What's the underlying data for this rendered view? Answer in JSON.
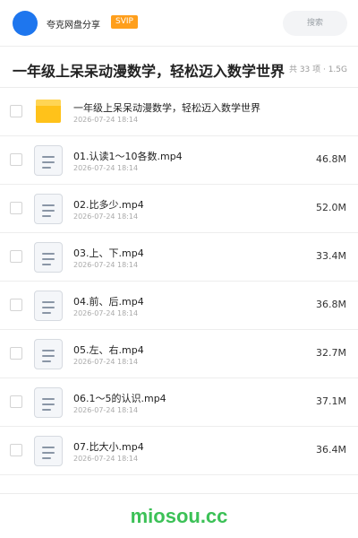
{
  "header": {
    "brand": "夸克网盘分享",
    "badge": "SVIP",
    "search_placeholder": "搜索"
  },
  "folder": {
    "title": "一年级上呆呆动漫数学，轻松迈入数学世界",
    "meta": "共 33 项 · 1.5G"
  },
  "items": [
    {
      "type": "folder",
      "name": "一年级上呆呆动漫数学，轻松迈入数学世界",
      "date": "2026-07-24 18:14",
      "size": ""
    },
    {
      "type": "file",
      "name": "01.认读1～10各数.mp4",
      "date": "2026-07-24 18:14",
      "size": "46.8M"
    },
    {
      "type": "file",
      "name": "02.比多少.mp4",
      "date": "2026-07-24 18:14",
      "size": "52.0M"
    },
    {
      "type": "file",
      "name": "03.上、下.mp4",
      "date": "2026-07-24 18:14",
      "size": "33.4M"
    },
    {
      "type": "file",
      "name": "04.前、后.mp4",
      "date": "2026-07-24 18:14",
      "size": "36.8M"
    },
    {
      "type": "file",
      "name": "05.左、右.mp4",
      "date": "2026-07-24 18:14",
      "size": "32.7M"
    },
    {
      "type": "file",
      "name": "06.1～5的认识.mp4",
      "date": "2026-07-24 18:14",
      "size": "37.1M"
    },
    {
      "type": "file",
      "name": "07.比大小.mp4",
      "date": "2026-07-24 18:14",
      "size": "36.4M"
    }
  ],
  "footer": {
    "watermark": "miosou.cc"
  },
  "colors": {
    "accent": "#1e76ee",
    "badge": "#ff9f1c",
    "folder": "#ffc21a",
    "watermark": "#3cc157"
  },
  "icons": {
    "folder": "folder-icon",
    "file": "video-file-icon"
  }
}
